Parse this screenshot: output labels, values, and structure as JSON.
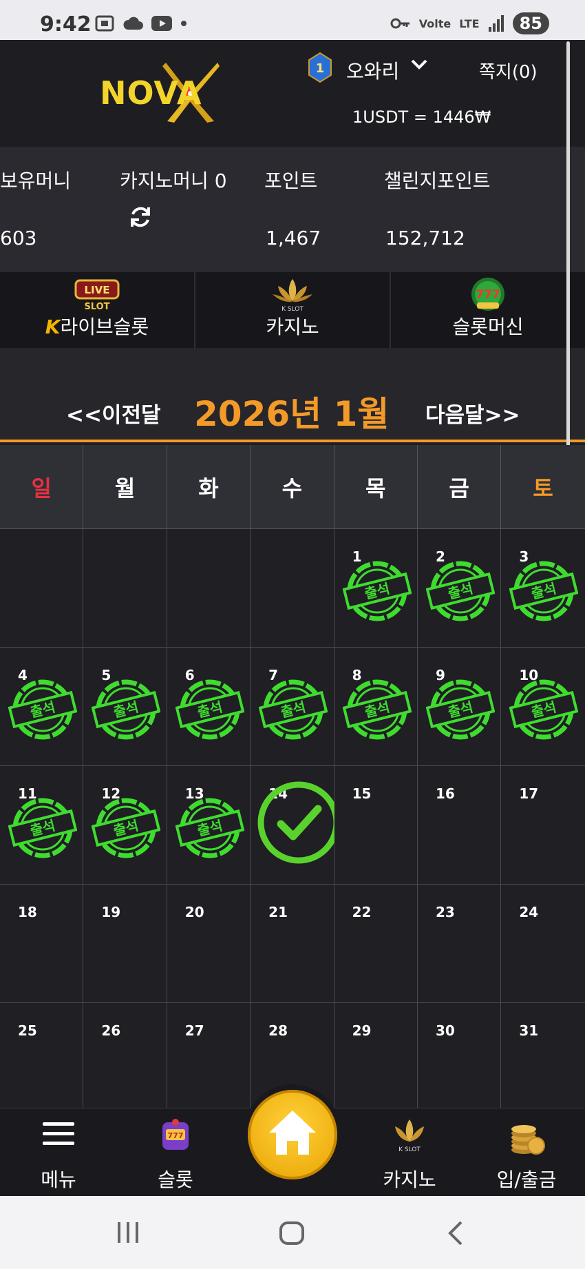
{
  "status_bar": {
    "time": "9:42",
    "network": "LTE",
    "volte": "Volte",
    "battery": "85",
    "left_icons": [
      "screenshot-icon",
      "cloud-icon",
      "youtube-icon",
      "dot-icon"
    ],
    "right_icons": [
      "key-icon",
      "signal-icon"
    ]
  },
  "header": {
    "logo_text": "NOVA",
    "level": "1",
    "username": "오와리",
    "messages": "쪽지(0)",
    "rate": "1USDT = 1446₩"
  },
  "balances": [
    {
      "label": "보유머니",
      "value": "603"
    },
    {
      "label": "카지노머니 0",
      "value": ""
    },
    {
      "label": "포인트",
      "value": "1,467"
    },
    {
      "label": "챌린지포인트",
      "value": "152,712"
    }
  ],
  "game_tabs": [
    {
      "label": "라이브슬롯",
      "badge": "K",
      "icon": "live-slot-icon",
      "icon_text": "LIVE SLOT"
    },
    {
      "label": "카지노",
      "icon": "kslot-lotus-icon",
      "icon_text": "K SLOT"
    },
    {
      "label": "슬롯머신",
      "icon": "777-slots-icon",
      "icon_text": "777"
    }
  ],
  "calendar": {
    "prev": "<<이전달",
    "month": "2026년 1월",
    "next": "다음달>>",
    "weekdays": [
      "일",
      "월",
      "화",
      "수",
      "목",
      "금",
      "토"
    ],
    "weekday_colors": {
      "sunday": "#e8313f",
      "saturday": "#f39a28",
      "default": "#ffffff"
    },
    "stamp_text": "출석",
    "today": 14,
    "attended_days": [
      1,
      2,
      3,
      4,
      5,
      6,
      7,
      8,
      9,
      10,
      11,
      12,
      13
    ],
    "weeks": [
      [
        "",
        "",
        "",
        "",
        "1",
        "2",
        "3"
      ],
      [
        "4",
        "5",
        "6",
        "7",
        "8",
        "9",
        "10"
      ],
      [
        "11",
        "12",
        "13",
        "14",
        "15",
        "16",
        "17"
      ],
      [
        "18",
        "19",
        "20",
        "21",
        "22",
        "23",
        "24"
      ],
      [
        "25",
        "26",
        "27",
        "28",
        "29",
        "30",
        "31"
      ]
    ]
  },
  "bottom_nav": [
    {
      "label": "메뉴",
      "icon": "hamburger-icon"
    },
    {
      "label": "슬롯",
      "icon": "slot-machine-icon"
    },
    {
      "label": "",
      "icon": "home-icon"
    },
    {
      "label": "카지노",
      "icon": "kslot-lotus-icon"
    },
    {
      "label": "입/출금",
      "icon": "coins-icon"
    }
  ],
  "colors": {
    "accent": "#f39a28",
    "stamp_green": "#3fdc2f",
    "check_green": "#5ad22d",
    "home_gold": "#f4b400"
  }
}
